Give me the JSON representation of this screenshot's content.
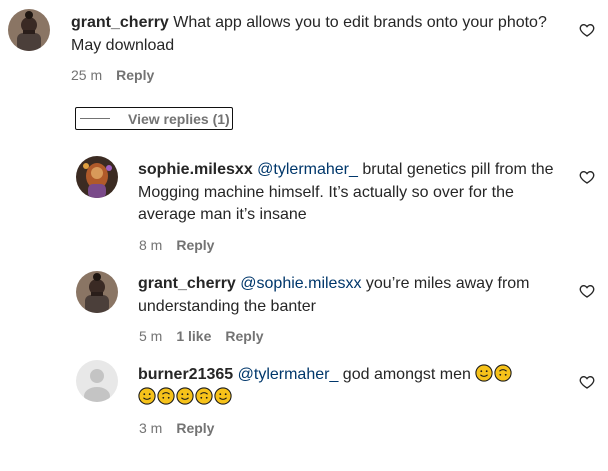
{
  "comments": [
    {
      "username": "grant_cherry",
      "mention": "",
      "text": "What app allows you to edit brands onto your photo? May download",
      "time": "25 m",
      "likes": "",
      "reply_label": "Reply"
    },
    {
      "username": "sophie.milesxx",
      "mention": "@tylermaher_",
      "text": "brutal genetics pill from the Mogging machine himself. It’s actually so over for the average man it’s insane",
      "time": "8 m",
      "likes": "",
      "reply_label": "Reply"
    },
    {
      "username": "grant_cherry",
      "mention": "@sophie.milesxx",
      "text": "you’re miles away from understanding the banter",
      "time": "5 m",
      "likes": "1 like",
      "reply_label": "Reply"
    },
    {
      "username": "burner21365",
      "mention": "@tylermaher_",
      "text": "god amongst men",
      "time": "3 m",
      "likes": "",
      "reply_label": "Reply"
    }
  ],
  "view_replies_label": "View replies (1)",
  "icons": {
    "like": "heart-outline-icon",
    "emoji_smile": "slightly-smiling-face",
    "emoji_upside": "upside-down-face"
  },
  "colors": {
    "text": "#262626",
    "secondary": "#737373",
    "mention": "#00376b",
    "emoji": "#f6c21a"
  }
}
